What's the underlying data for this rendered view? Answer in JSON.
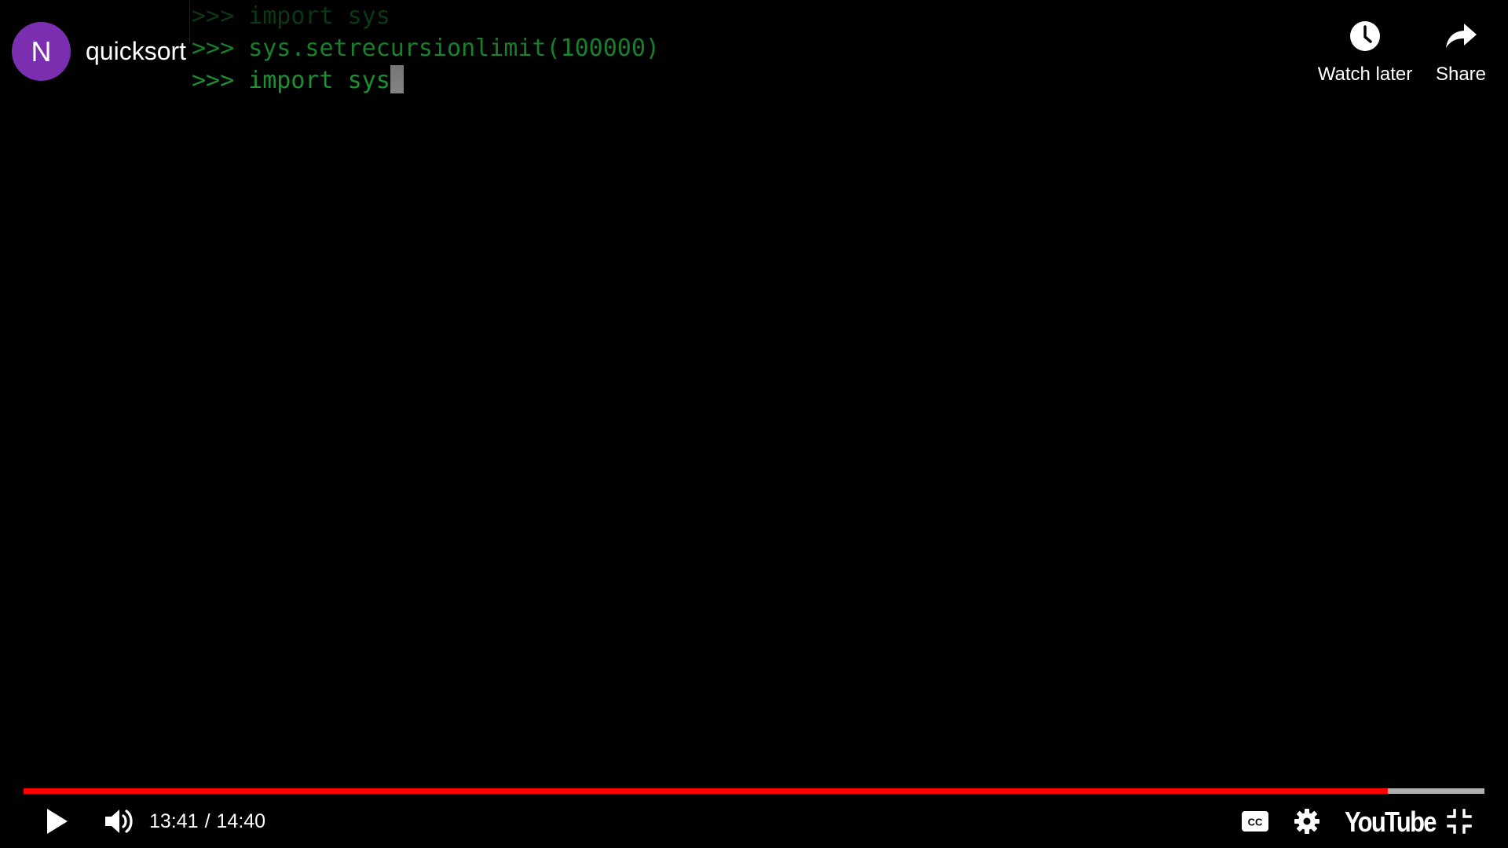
{
  "video": {
    "terminal_lines": [
      {
        "prompt": ">>>",
        "code": "import sys",
        "dim": true
      },
      {
        "prompt": ">>>",
        "code": "sys.setrecursionlimit(100000)",
        "dim": false
      },
      {
        "prompt": ">>>",
        "code": "import sys",
        "dim": false,
        "cursor": true
      }
    ],
    "text_color": "#1f9e37"
  },
  "header": {
    "channel_initial": "N",
    "avatar_color": "#7b2fb0",
    "title": "quicksort",
    "watch_later_label": "Watch later",
    "share_label": "Share",
    "watch_later_icon": "clock-icon",
    "share_icon": "share-arrow-icon"
  },
  "controls": {
    "current_time": "13:41",
    "separator": "/",
    "duration": "14:40",
    "progress_played_fraction": 0.934,
    "progress_loaded_fraction": 1.0,
    "progress_color": "#ff0000",
    "logo_text": "YouTube",
    "icons": {
      "play": "play-icon",
      "volume": "volume-icon",
      "captions": "cc-icon",
      "settings": "gear-icon",
      "fullscreen": "exit-fullscreen-icon"
    }
  }
}
